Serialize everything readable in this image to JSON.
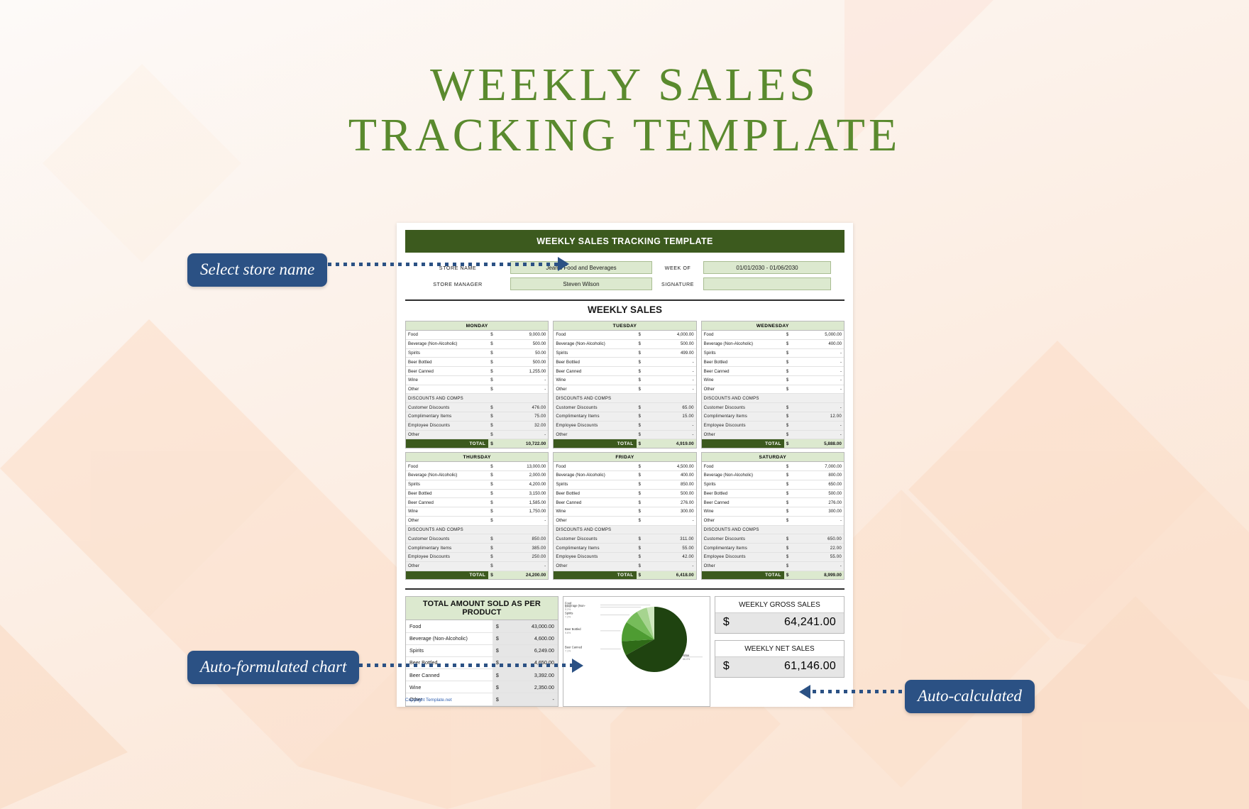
{
  "page": {
    "title_line1": "WEEKLY SALES",
    "title_line2": "TRACKING TEMPLATE",
    "accent_green": "#5a8a2e",
    "dark_green": "#3c5a1e",
    "callout_blue": "#2b5184"
  },
  "document": {
    "header": "WEEKLY SALES TRACKING TEMPLATE",
    "fields": {
      "store_name_label": "STORE NAME",
      "store_name_value": "Jean's Food and Beverages",
      "store_manager_label": "STORE MANAGER",
      "store_manager_value": "Steven Wilson",
      "week_of_label": "WEEK OF",
      "week_of_value": "01/01/2030 - 01/06/2030",
      "signature_label": "SIGNATURE",
      "signature_value": ""
    },
    "section_title": "WEEKLY SALES",
    "total_label": "TOTAL",
    "currency": "$",
    "dash": "-",
    "subheader": "DISCOUNTS AND COMPS",
    "copyright": "Copyright Template.net"
  },
  "row_labels": [
    "Food",
    "Beverage (Non-Alcoholic)",
    "Spirits",
    "Beer Bottled",
    "Beer Canned",
    "Wine",
    "Other"
  ],
  "discount_labels": [
    "Customer Discounts",
    "Complimentary Items",
    "Employee Discounts",
    "Other"
  ],
  "days": [
    {
      "name": "MONDAY",
      "sales": [
        "9,000.00",
        "500.00",
        "50.00",
        "500.00",
        "1,255.00",
        "-",
        "-"
      ],
      "discounts": [
        "476.00",
        "75.00",
        "32.00",
        "-"
      ],
      "total": "10,722.00"
    },
    {
      "name": "TUESDAY",
      "sales": [
        "4,000.00",
        "500.00",
        "499.00",
        "-",
        "-",
        "-",
        "-"
      ],
      "discounts": [
        "65.00",
        "15.00",
        "-",
        "-"
      ],
      "total": "4,919.00"
    },
    {
      "name": "WEDNESDAY",
      "sales": [
        "5,000.00",
        "400.00",
        "-",
        "-",
        "-",
        "-",
        "-"
      ],
      "discounts": [
        "-",
        "12.00",
        "-",
        "-"
      ],
      "total": "5,888.00"
    },
    {
      "name": "THURSDAY",
      "sales": [
        "13,000.00",
        "2,000.00",
        "4,200.00",
        "3,150.00",
        "1,585.00",
        "1,750.00",
        "-"
      ],
      "discounts": [
        "850.00",
        "385.00",
        "250.00",
        "-"
      ],
      "total": "24,200.00"
    },
    {
      "name": "FRIDAY",
      "sales": [
        "4,500.00",
        "400.00",
        "850.00",
        "500.00",
        "276.00",
        "300.00",
        "-"
      ],
      "discounts": [
        "311.00",
        "55.00",
        "42.00",
        "-"
      ],
      "total": "6,418.00"
    },
    {
      "name": "SATURDAY",
      "sales": [
        "7,000.00",
        "800.00",
        "650.00",
        "500.00",
        "276.00",
        "300.00",
        "-"
      ],
      "discounts": [
        "650.00",
        "22.00",
        "55.00",
        "-"
      ],
      "total": "8,999.00"
    }
  ],
  "product_totals": {
    "title": "TOTAL AMOUNT SOLD AS PER PRODUCT",
    "rows": [
      {
        "label": "Food",
        "value": "43,000.00"
      },
      {
        "label": "Beverage (Non-Alcoholic)",
        "value": "4,600.00"
      },
      {
        "label": "Spirits",
        "value": "6,249.00"
      },
      {
        "label": "Beer Bottled",
        "value": "4,650.00"
      },
      {
        "label": "Beer Canned",
        "value": "3,392.00"
      },
      {
        "label": "Wine",
        "value": "2,350.00"
      },
      {
        "label": "Other",
        "value": "-"
      }
    ]
  },
  "chart_data": {
    "type": "pie",
    "title": "",
    "categories": [
      "Food",
      "Beverage (Non-Alcoholic)",
      "Spirits",
      "Beer Bottled",
      "Beer Canned",
      "Wine"
    ],
    "values": [
      43000,
      4600,
      6249,
      4650,
      3392,
      2350
    ],
    "percent_labels": [
      "66.0%",
      "7.1%",
      "9.6%",
      "7.2%",
      "5.2%",
      "3.7%"
    ],
    "colors": [
      "#1f4310",
      "#2f6b18",
      "#4e9c32",
      "#76bc5a",
      "#a6d48f",
      "#cfe7bf"
    ],
    "labels_visible": [
      "Wine",
      "Beer Canned",
      "Beer Bottled",
      "Spirits",
      "Beverage (Non-",
      "Food"
    ],
    "legend": "none"
  },
  "sales_summary": [
    {
      "label": "WEEKLY GROSS SALES",
      "currency": "$",
      "amount": "64,241.00"
    },
    {
      "label": "WEEKLY NET SALES",
      "currency": "$",
      "amount": "61,146.00"
    }
  ],
  "callouts": [
    {
      "id": "store",
      "text": "Select store name"
    },
    {
      "id": "chart",
      "text": "Auto-formulated chart"
    },
    {
      "id": "calc",
      "text": "Auto-calculated"
    }
  ]
}
